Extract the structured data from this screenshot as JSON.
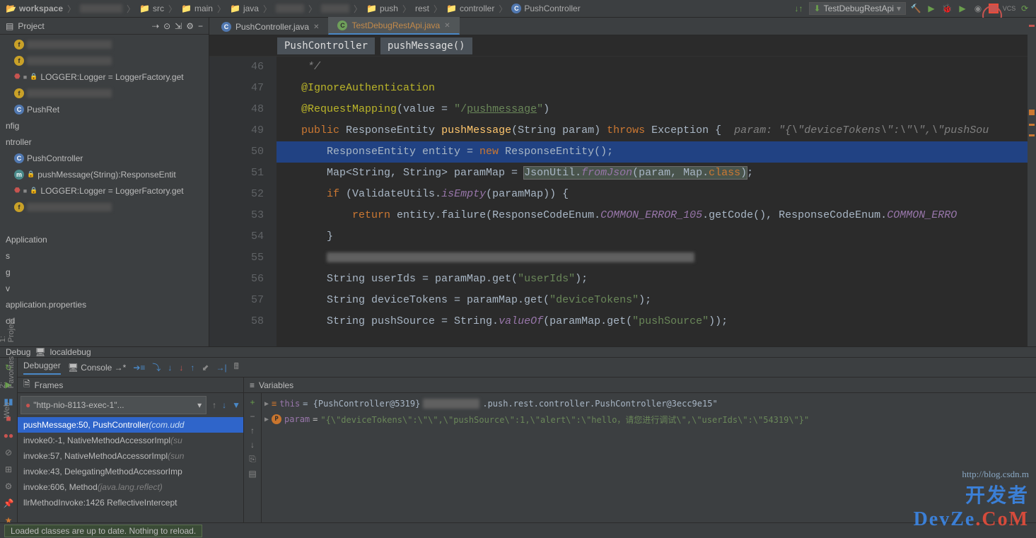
{
  "nav": {
    "items": [
      "workspace",
      "",
      "src",
      "main",
      "java",
      "",
      "",
      "push",
      "rest",
      "controller",
      "PushController"
    ],
    "config": "TestDebugRestApi"
  },
  "sidebar": {
    "title": "Project",
    "items": [
      {
        "icon": "f",
        "text": "",
        "blur": true,
        "indent": 12
      },
      {
        "icon": "f",
        "text": "",
        "blur": true,
        "indent": 12
      },
      {
        "icon": "logger",
        "text": "LOGGER:Logger = LoggerFactory.get",
        "indent": 12
      },
      {
        "icon": "f",
        "text": "",
        "blur": true,
        "indent": 12
      },
      {
        "icon": "c",
        "text": "PushRet",
        "indent": 12
      },
      {
        "icon": "",
        "text": "nfig",
        "indent": 0
      },
      {
        "icon": "",
        "text": "ntroller",
        "indent": 0
      },
      {
        "icon": "c",
        "text": "PushController",
        "indent": 12
      },
      {
        "icon": "m",
        "text": "pushMessage(String):ResponseEntit",
        "indent": 12
      },
      {
        "icon": "logger",
        "text": "LOGGER:Logger = LoggerFactory.get",
        "indent": 12
      },
      {
        "icon": "f",
        "text": "",
        "blur": true,
        "indent": 12
      },
      {
        "icon": "",
        "text": "",
        "indent": 0
      },
      {
        "icon": "",
        "text": "Application",
        "indent": 0
      },
      {
        "icon": "",
        "text": "s",
        "indent": 0
      },
      {
        "icon": "",
        "text": "g",
        "indent": 0
      },
      {
        "icon": "",
        "text": "v",
        "indent": 0
      },
      {
        "icon": "",
        "text": "application.properties",
        "indent": 0
      },
      {
        "icon": "",
        "text": "od",
        "indent": 0
      }
    ]
  },
  "tabs": [
    {
      "label": "PushController.java",
      "active": false
    },
    {
      "label": "TestDebugRestApi.java",
      "active": true,
      "test": true
    }
  ],
  "breadcrumb": [
    "PushController",
    "pushMessage()"
  ],
  "code": {
    "lines": [
      {
        "n": 46,
        "html": "    <span class='c-comment'>*/</span>"
      },
      {
        "n": 47,
        "html": "   <span class='c-anno'>@IgnoreAuthentication</span>"
      },
      {
        "n": 48,
        "html": "   <span class='c-anno'>@RequestMapping</span>(value = <span class='c-str'>\"/<span style='text-decoration:underline'>pushmessage</span>\"</span>)"
      },
      {
        "n": 49,
        "html": "   <span class='c-kw'>public</span> ResponseEntity <span class='c-method'>pushMessage</span>(String param) <span class='c-kw'>throws</span> Exception {  <span class='c-param'>param: \"{\\\"deviceTokens\\\":\\\"\\\",\\\"pushSou</span>"
      },
      {
        "n": 50,
        "html": "       ResponseEntity entity = <span class='c-kw'>new</span> ResponseEntity();",
        "hl": true,
        "bp": true
      },
      {
        "n": 51,
        "html": "       Map&lt;String, String&gt; paramMap = <span class='c-boxed'>JsonUtil.<span class='c-const'>fromJson</span>(param, Map.<span class='c-kw'>class</span>)</span>;"
      },
      {
        "n": 52,
        "html": "       <span class='c-kw'>if</span> (ValidateUtils.<span class='c-const'>isEmpty</span>(paramMap)) {"
      },
      {
        "n": 53,
        "html": "           <span class='c-kw'>return</span> entity.failure(ResponseCodeEnum.<span class='c-const'>COMMON_ERROR_105</span>.getCode(), ResponseCodeEnum.<span class='c-const'>COMMON_ERRO</span>"
      },
      {
        "n": 54,
        "html": "       }"
      },
      {
        "n": 55,
        "html": "       <span class='blur-code' style='width:520px'></span>"
      },
      {
        "n": 56,
        "html": "       String userIds = paramMap.get(<span class='c-str'>\"userIds\"</span>);"
      },
      {
        "n": 57,
        "html": "       String deviceTokens = paramMap.get(<span class='c-str'>\"deviceTokens\"</span>);"
      },
      {
        "n": 58,
        "html": "       String pushSource = String.<span class='c-const'>valueOf</span>(paramMap.get(<span class='c-str'>\"pushSource\"</span>));"
      }
    ]
  },
  "debug": {
    "title": "Debug",
    "config": "localdebug",
    "subtabs": {
      "debugger": "Debugger",
      "console": "Console"
    },
    "frames_label": "Frames",
    "vars_label": "Variables",
    "thread": "\"http-nio-8113-exec-1\"...",
    "frames": [
      {
        "text": "pushMessage:50, PushController",
        "pkg": "(com.udd",
        "sel": true
      },
      {
        "text": "invoke0:-1, NativeMethodAccessorImpl",
        "pkg": "(su"
      },
      {
        "text": "invoke:57, NativeMethodAccessorImpl",
        "pkg": "(sun"
      },
      {
        "text": "invoke:43, DelegatingMethodAccessorImp",
        "pkg": ""
      },
      {
        "text": "invoke:606, Method",
        "pkg": "(java.lang.reflect)"
      },
      {
        "text": "llrMethodInvoke:1426 ReflectiveIntercept",
        "pkg": ""
      }
    ],
    "vars": [
      {
        "icon": "this",
        "name": "this",
        "val": "{PushController@5319}",
        "suffix": ".push.rest.controller.PushController@3ecc9e15\""
      },
      {
        "icon": "p",
        "name": "param",
        "val": "\"{\\\"deviceTokens\\\":\\\"\\\",\\\"pushSource\\\":1,\\\"alert\\\":\\\"hello，请您进行调试\\\",\\\"userIds\\\":\\\"54319\\\"}\""
      }
    ]
  },
  "status": "Loaded classes are up to date. Nothing to reload.",
  "watermark": {
    "link": "http://blog.csdn.m",
    "logo1": "开发者",
    "logo2": "DevZe.CoM"
  },
  "rail": [
    "1: Project",
    "2: Favorites",
    "Web"
  ]
}
